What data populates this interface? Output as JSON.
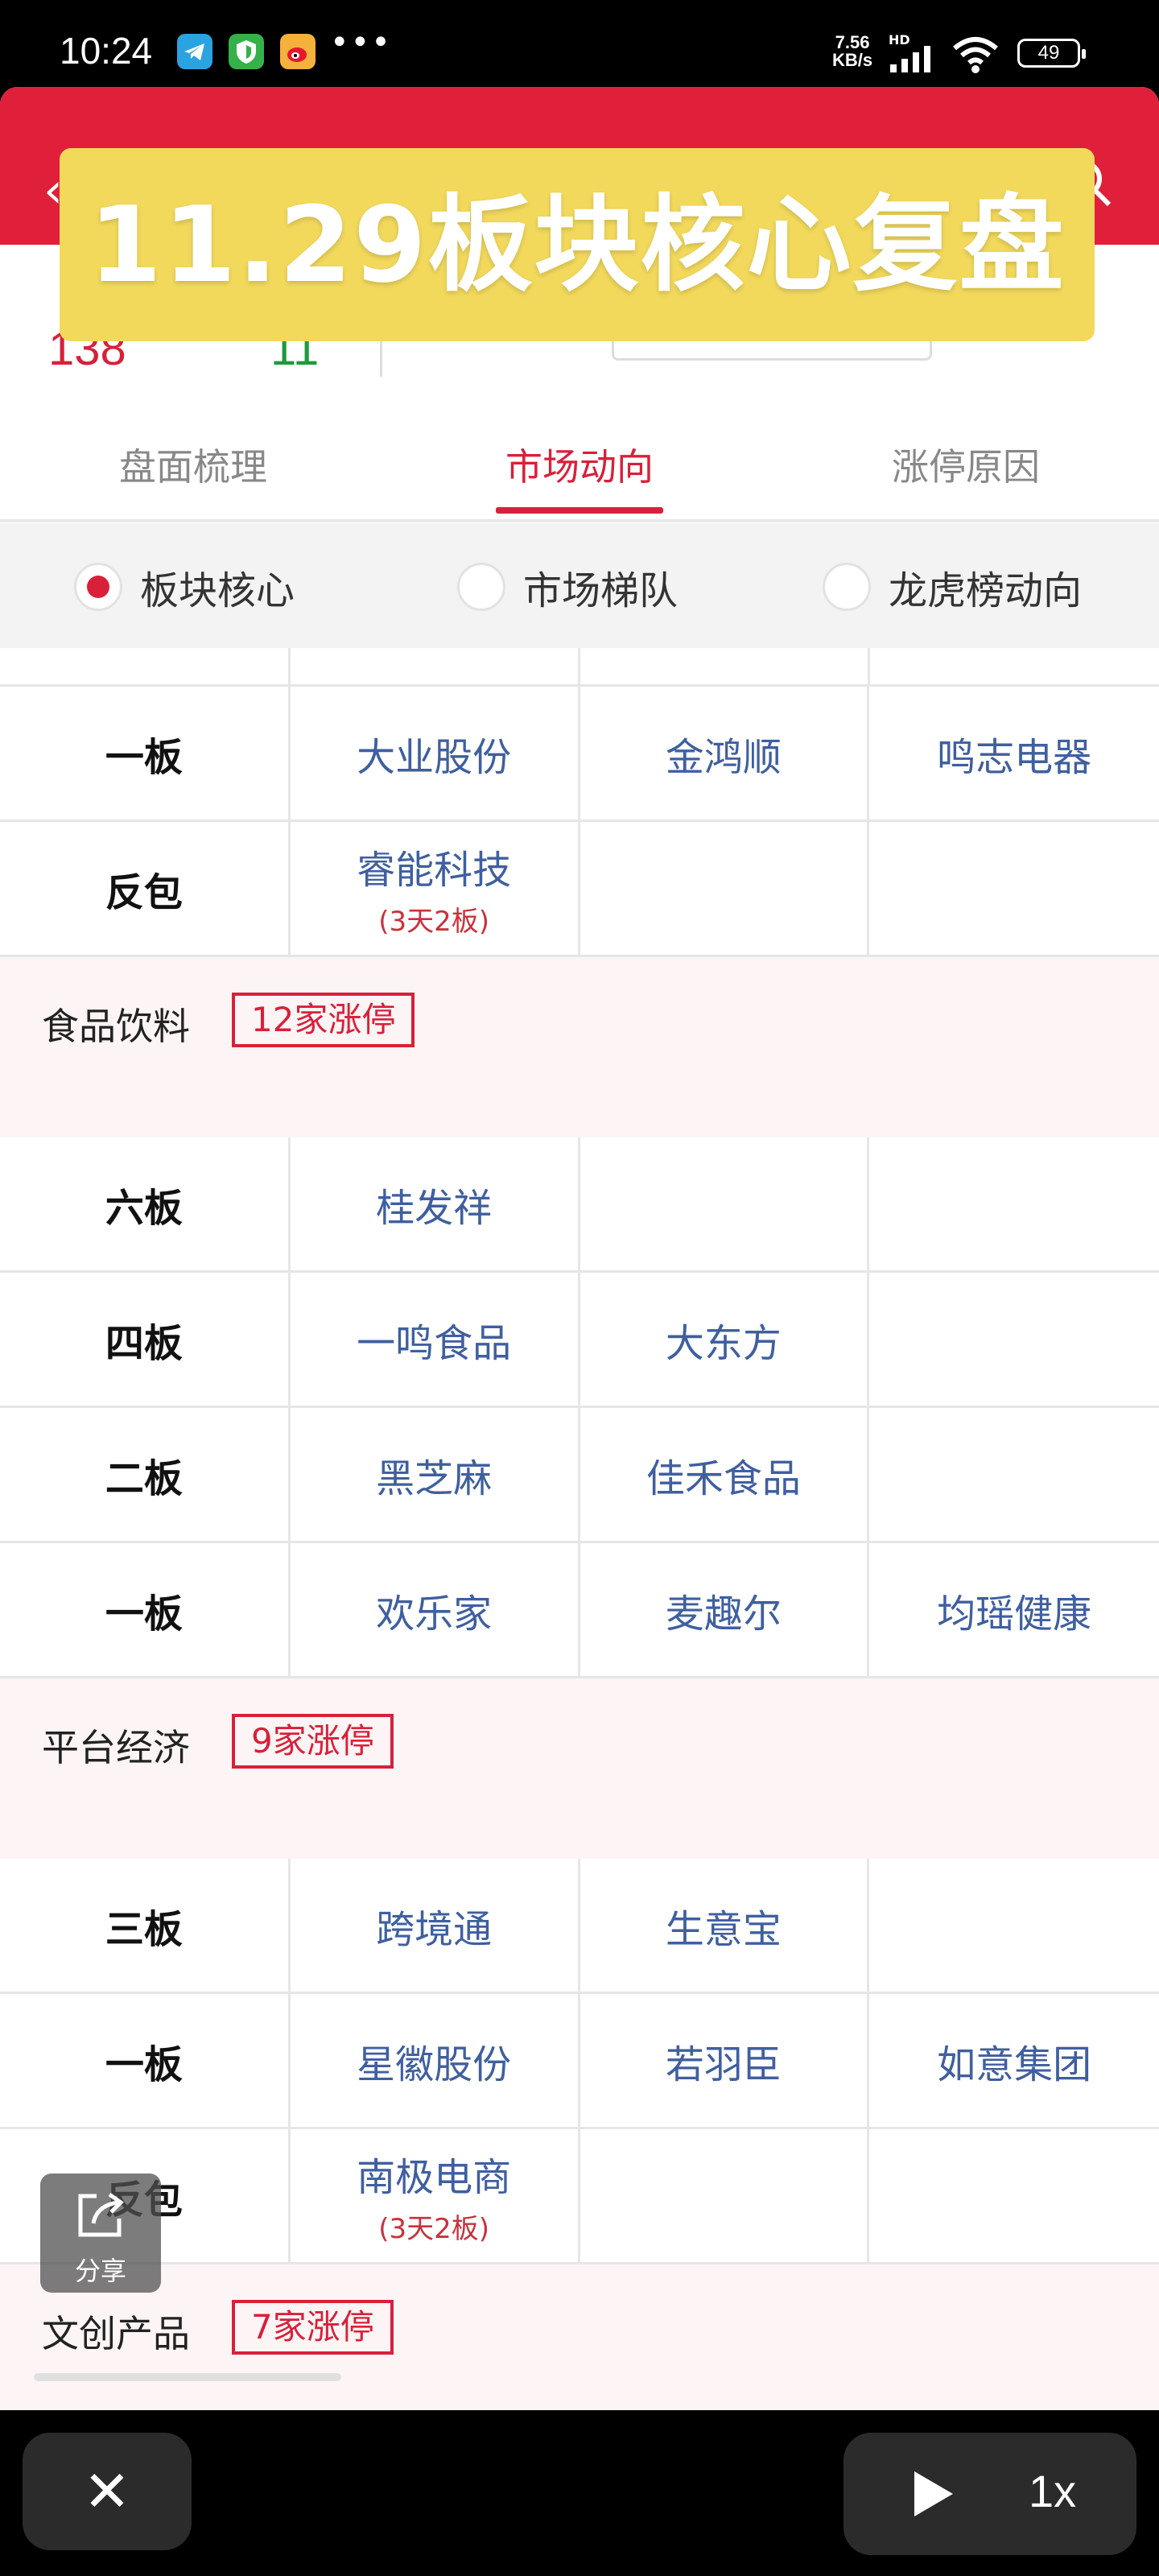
{
  "status_bar": {
    "time": "10:24",
    "dots": "•••",
    "net_speed_value": "7.56",
    "net_speed_unit": "KB/s",
    "hd": "HD",
    "battery": "49"
  },
  "header": {
    "banner_text": "11.29板块核心复盘",
    "stat_left": "138",
    "stat_mid": "11"
  },
  "tabs": [
    {
      "label": "盘面梳理",
      "active": false
    },
    {
      "label": "市场动向",
      "active": true
    },
    {
      "label": "涨停原因",
      "active": false
    }
  ],
  "radios": [
    {
      "label": "板块核心",
      "selected": true
    },
    {
      "label": "市场梯队",
      "selected": false
    },
    {
      "label": "龙虎榜动向",
      "selected": false
    }
  ],
  "top_rows": [
    {
      "level": "一板",
      "stocks": [
        {
          "name": "大业股份"
        },
        {
          "name": "金鸿顺"
        },
        {
          "name": "鸣志电器"
        }
      ]
    },
    {
      "level": "反包",
      "stocks": [
        {
          "name": "睿能科技",
          "note": "(3天2板)"
        },
        {
          "name": ""
        },
        {
          "name": ""
        }
      ]
    }
  ],
  "sections": [
    {
      "title": "食品饮料",
      "badge": "12家涨停",
      "rows": [
        {
          "level": "六板",
          "stocks": [
            {
              "name": "桂发祥"
            },
            {
              "name": ""
            },
            {
              "name": ""
            }
          ]
        },
        {
          "level": "四板",
          "stocks": [
            {
              "name": "一鸣食品"
            },
            {
              "name": "大东方"
            },
            {
              "name": ""
            }
          ]
        },
        {
          "level": "二板",
          "stocks": [
            {
              "name": "黑芝麻"
            },
            {
              "name": "佳禾食品"
            },
            {
              "name": ""
            }
          ]
        },
        {
          "level": "一板",
          "stocks": [
            {
              "name": "欢乐家"
            },
            {
              "name": "麦趣尔"
            },
            {
              "name": "均瑶健康"
            }
          ]
        }
      ]
    },
    {
      "title": "平台经济",
      "badge": "9家涨停",
      "rows": [
        {
          "level": "三板",
          "stocks": [
            {
              "name": "跨境通"
            },
            {
              "name": "生意宝"
            },
            {
              "name": ""
            }
          ]
        },
        {
          "level": "一板",
          "stocks": [
            {
              "name": "星徽股份"
            },
            {
              "name": "若羽臣"
            },
            {
              "name": "如意集团"
            }
          ]
        },
        {
          "level": "反包",
          "stocks": [
            {
              "name": "南极电商",
              "note": "(3天2板)"
            },
            {
              "name": ""
            },
            {
              "name": ""
            }
          ]
        }
      ]
    },
    {
      "title": "文创产品",
      "badge": "7家涨停",
      "rows": []
    }
  ],
  "share": {
    "label": "分享",
    "icon": "share-icon"
  },
  "player": {
    "close_icon": "✕",
    "speed": "1x"
  }
}
